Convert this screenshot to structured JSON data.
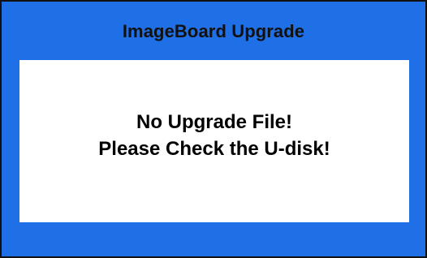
{
  "dialog": {
    "title": "ImageBoard Upgrade",
    "message_line1": "No Upgrade File!",
    "message_line2": "Please Check the U-disk!"
  },
  "colors": {
    "frame_blue": "#1f6fe6",
    "panel_white": "#ffffff",
    "text_black": "#000000"
  }
}
